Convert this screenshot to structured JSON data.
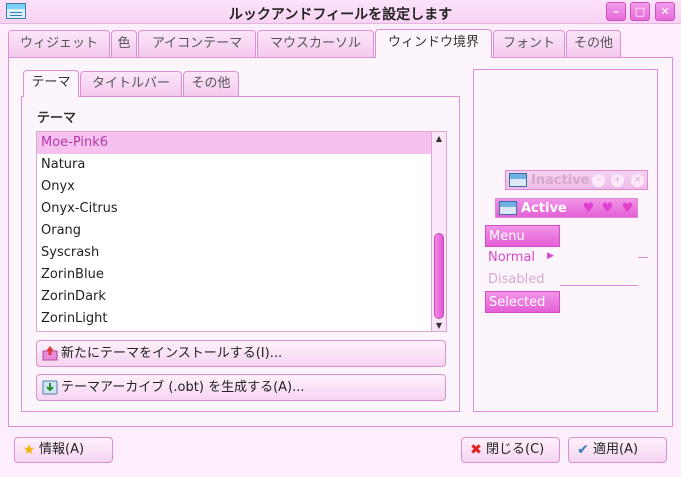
{
  "window": {
    "title": "ルックアンドフィールを設定します",
    "buttons": {
      "minimize": "–",
      "maximize": "□",
      "close": "✕"
    }
  },
  "main_tabs": [
    "ウィジェット",
    "色",
    "アイコンテーマ",
    "マウスカーソル",
    "ウィンドウ境界",
    "フォント",
    "その他"
  ],
  "main_tab_active": "ウィンドウ境界",
  "inner_tabs": [
    "テーマ",
    "タイトルバー",
    "その他"
  ],
  "inner_tab_active": "テーマ",
  "theme_section": {
    "heading": "テーマ",
    "themes": [
      "Moe-Pink6",
      "Natura",
      "Onyx",
      "Onyx-Citrus",
      "Orang",
      "Syscrash",
      "ZorinBlue",
      "ZorinDark",
      "ZorinLight"
    ],
    "selected": "Moe-Pink6"
  },
  "actions": {
    "install_label": "新たにテーマをインストールする(I)...",
    "archive_label": "テーマアーカイブ (.obt) を生成する(A)..."
  },
  "preview": {
    "inactive_title": "Inactive",
    "active_title": "Active",
    "menu_label": "Menu",
    "normal_label": "Normal",
    "disabled_label": "Disabled",
    "selected_label": "Selected"
  },
  "footer": {
    "info_label": "情報(A)",
    "close_label": "閉じる(C)",
    "apply_label": "適用(A)"
  },
  "colors": {
    "accent": "#e356d4",
    "selection_bg": "#f6c1ef",
    "selection_text": "#b43aa6"
  }
}
